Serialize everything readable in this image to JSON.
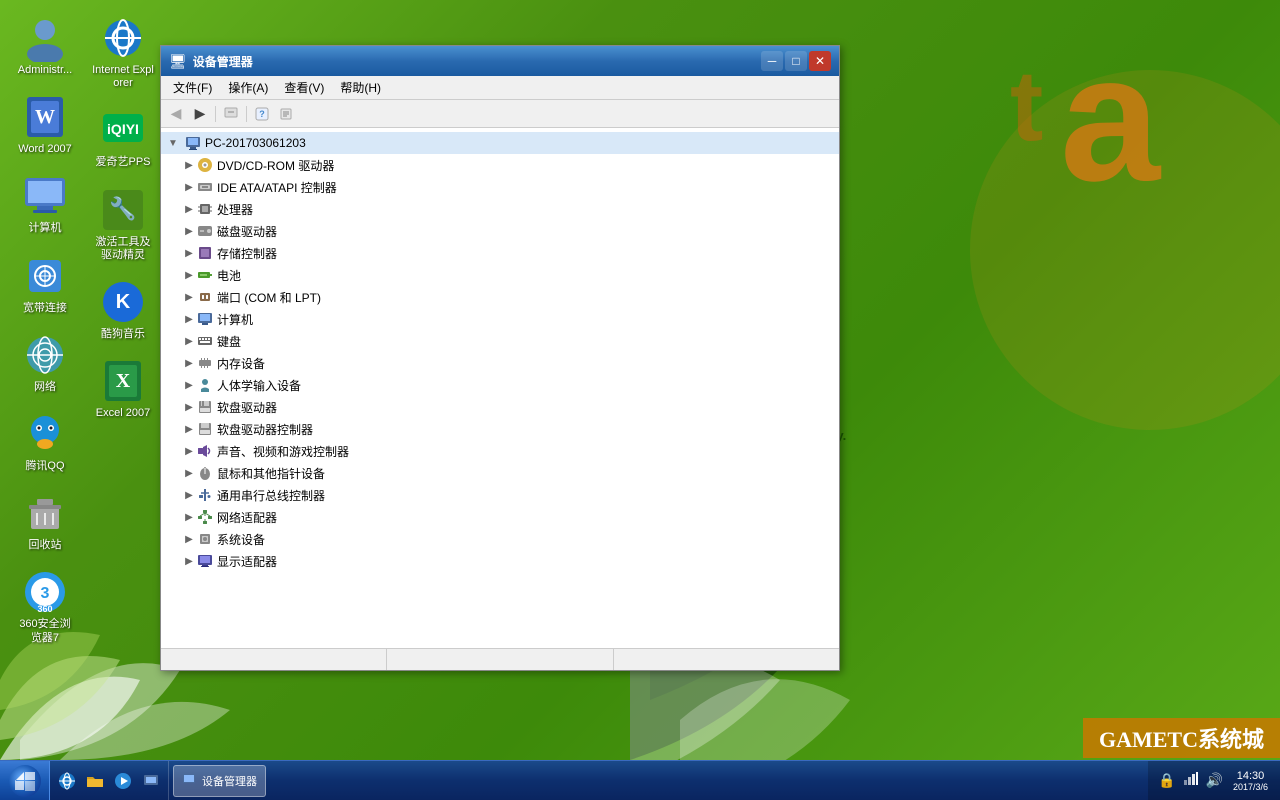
{
  "desktop": {
    "background_color": "#5a9e1a",
    "brand_text": "Special for you, Green & Safety."
  },
  "desktop_icons": [
    {
      "id": "admin",
      "label": "Administr...",
      "icon": "👤",
      "row": 0
    },
    {
      "id": "word2007",
      "label": "Word 2007",
      "icon": "📝",
      "row": 1
    },
    {
      "id": "computer",
      "label": "计算机",
      "icon": "🖥",
      "row": 2
    },
    {
      "id": "broadband",
      "label": "宽带连接",
      "icon": "🌐",
      "row": 3
    },
    {
      "id": "network",
      "label": "网络",
      "icon": "🌍",
      "row": 4
    },
    {
      "id": "qq",
      "label": "腾讯QQ",
      "icon": "🐧",
      "row": 5
    },
    {
      "id": "recycle",
      "label": "回收站",
      "icon": "🗑",
      "row": 6
    },
    {
      "id": "360browser",
      "label": "360安全浏览器7",
      "icon": "🛡",
      "row": 7
    },
    {
      "id": "ie",
      "label": "Internet Explorer",
      "icon": "🌐",
      "row": 8
    },
    {
      "id": "iqiyi",
      "label": "爱奇艺PPS",
      "icon": "▶",
      "row": 9
    },
    {
      "id": "tools",
      "label": "激活工具及驱动精灵",
      "icon": "🔧",
      "row": 10
    },
    {
      "id": "kugou",
      "label": "酷狗音乐",
      "icon": "🎵",
      "row": 11
    },
    {
      "id": "excel2007",
      "label": "Excel 2007",
      "icon": "📊",
      "row": 12
    }
  ],
  "window": {
    "title": "设备管理器",
    "title_icon": "🖥",
    "menu_items": [
      "文件(F)",
      "操作(A)",
      "查看(V)",
      "帮助(H)"
    ],
    "toolbar_buttons": [
      "←",
      "→",
      "🔄",
      "❓",
      "📋"
    ],
    "computer_name": "PC-201703061203",
    "tree_items": [
      {
        "label": "DVD/CD-ROM 驱动器",
        "indent": 1,
        "icon": "💿",
        "icon_class": "icon-dvd"
      },
      {
        "label": "IDE ATA/ATAPI 控制器",
        "indent": 1,
        "icon": "🔌",
        "icon_class": "icon-ide"
      },
      {
        "label": "处理器",
        "indent": 1,
        "icon": "⚙",
        "icon_class": "icon-cpu"
      },
      {
        "label": "磁盘驱动器",
        "indent": 1,
        "icon": "💾",
        "icon_class": "icon-hdd"
      },
      {
        "label": "存储控制器",
        "indent": 1,
        "icon": "📦",
        "icon_class": "icon-storage"
      },
      {
        "label": "电池",
        "indent": 1,
        "icon": "🔋",
        "icon_class": "icon-battery"
      },
      {
        "label": "端口 (COM 和 LPT)",
        "indent": 1,
        "icon": "🔌",
        "icon_class": "icon-port"
      },
      {
        "label": "计算机",
        "indent": 1,
        "icon": "🖥",
        "icon_class": "icon-pc"
      },
      {
        "label": "键盘",
        "indent": 1,
        "icon": "⌨",
        "icon_class": "icon-keyboard"
      },
      {
        "label": "内存设备",
        "indent": 1,
        "icon": "📋",
        "icon_class": "icon-memory"
      },
      {
        "label": "人体学输入设备",
        "indent": 1,
        "icon": "🖱",
        "icon_class": "icon-human"
      },
      {
        "label": "软盘驱动器",
        "indent": 1,
        "icon": "💾",
        "icon_class": "icon-floppy"
      },
      {
        "label": "软盘驱动器控制器",
        "indent": 1,
        "icon": "💾",
        "icon_class": "icon-floppyctrl"
      },
      {
        "label": "声音、视频和游戏控制器",
        "indent": 1,
        "icon": "🔊",
        "icon_class": "icon-sound"
      },
      {
        "label": "鼠标和其他指针设备",
        "indent": 1,
        "icon": "🖱",
        "icon_class": "icon-mouse"
      },
      {
        "label": "通用串行总线控制器",
        "indent": 1,
        "icon": "🔌",
        "icon_class": "icon-usb"
      },
      {
        "label": "网络适配器",
        "indent": 1,
        "icon": "🌐",
        "icon_class": "icon-network"
      },
      {
        "label": "系统设备",
        "indent": 1,
        "icon": "⚙",
        "icon_class": "icon-system"
      },
      {
        "label": "显示适配器",
        "indent": 1,
        "icon": "🖥",
        "icon_class": "icon-display"
      }
    ]
  },
  "taskbar": {
    "start_icon": "⊞",
    "quick_launch": [
      {
        "id": "ie-quick",
        "icon": "🌐"
      },
      {
        "id": "folder-quick",
        "icon": "📁"
      },
      {
        "id": "media-quick",
        "icon": "▶"
      },
      {
        "id": "device-quick",
        "icon": "🖥"
      }
    ],
    "active_window": "设备管理器",
    "tray_icons": [
      "🔒",
      "🌐",
      "🔊"
    ],
    "time": "14:30",
    "date": "2017/3/6"
  },
  "watermark": {
    "text": "GAMETC系统城"
  }
}
